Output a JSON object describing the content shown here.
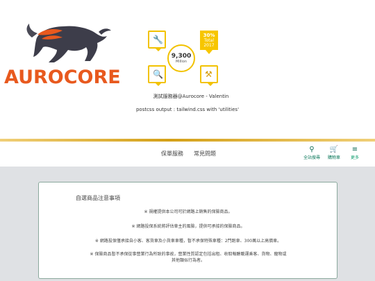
{
  "brand": {
    "name": "AUROCORE",
    "accent": "#e8591e",
    "bull_color": "#3d3d4a"
  },
  "stats": {
    "center_value": "9,300",
    "center_unit": "Million",
    "badge_top": "30%",
    "badge_line1": "Total",
    "badge_line2": "2017",
    "icons": [
      "wrench-icon",
      "search-document-icon",
      "tools-icon"
    ],
    "accent": "#f2c200"
  },
  "header": {
    "line1": "測試服務器@Aurocore - Valentin",
    "line2": "postcss output : tailwind.css with 'utilities'"
  },
  "nav": {
    "service": "保單服務",
    "faq": "常見問題",
    "search_label": "全站搜尋",
    "cart_label": "購物車",
    "more_label": "更多"
  },
  "notice": {
    "title": "自選商品注意事項",
    "items": [
      "※ 規權提供本公司可於網路上銷售的保險商品。",
      "※ 網路投保系統將評估車主的風險，提供可承接的保險商品。",
      "※ 網路投保僅承接自小客、客貨車及小貨車車種，暫不承保特殊車種：2門跑車、300萬以上高價車。",
      "※ 保險商品暫不承保從事營業行為所致的事故，營業性質認定包括出租、收取報酬載運乘客、貨物、寵物或",
      "其他類似行為者。"
    ]
  }
}
